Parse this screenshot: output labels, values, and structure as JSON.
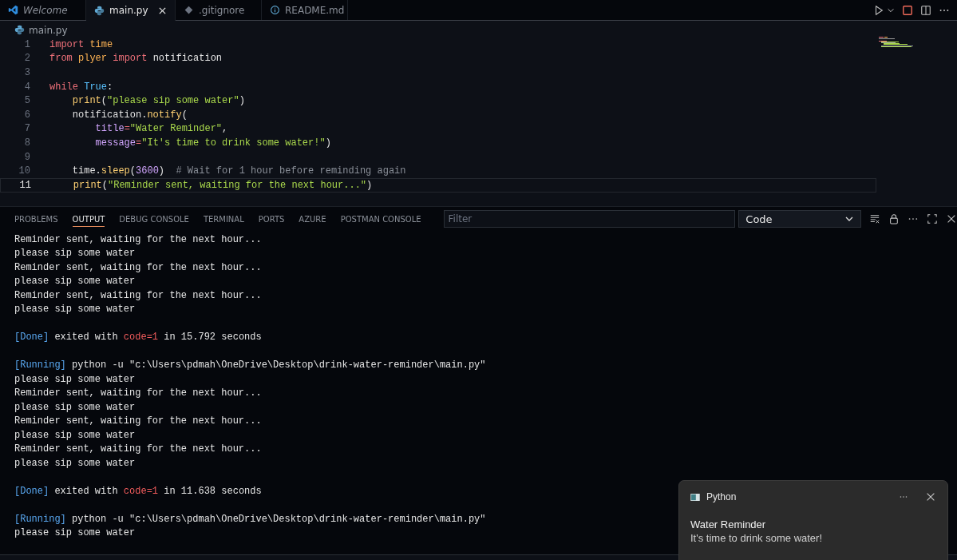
{
  "editor_tabs": [
    {
      "label": "Welcome",
      "kind": "vscode",
      "selected": false,
      "italic": true
    },
    {
      "label": "main.py",
      "kind": "python",
      "selected": true,
      "italic": false
    },
    {
      "label": ".gitignore",
      "kind": "git",
      "selected": false,
      "italic": false
    },
    {
      "label": "README.md",
      "kind": "info",
      "selected": false,
      "italic": false
    }
  ],
  "breadcrumb": "main.py",
  "code_lines": [
    {
      "number": "1",
      "current": false,
      "tokens": [
        {
          "kind": "keyword",
          "text": "import"
        },
        {
          "kind": "module",
          "text": " time"
        }
      ]
    },
    {
      "number": "2",
      "current": false,
      "tokens": [
        {
          "kind": "keyword",
          "text": "from"
        },
        {
          "kind": "module",
          "text": " plyer"
        },
        {
          "kind": "keyword",
          "text": " import"
        },
        {
          "kind": "plain",
          "text": " notification"
        }
      ]
    },
    {
      "number": "3",
      "current": false
    },
    {
      "number": "4",
      "current": false,
      "tokens": [
        {
          "kind": "keyword",
          "text": "while"
        },
        {
          "kind": "constant",
          "text": " True"
        },
        {
          "kind": "plain",
          "text": ":"
        }
      ]
    },
    {
      "number": "5",
      "current": false,
      "tokens": [
        {
          "kind": "func",
          "text": "    print"
        },
        {
          "kind": "plain",
          "text": "("
        },
        {
          "kind": "string",
          "text": "\"please sip some water\""
        },
        {
          "kind": "plain",
          "text": ")"
        }
      ]
    },
    {
      "number": "6",
      "current": false,
      "tokens": [
        {
          "kind": "plain",
          "text": "    notification."
        },
        {
          "kind": "func",
          "text": "notify"
        },
        {
          "kind": "plain",
          "text": "("
        }
      ]
    },
    {
      "number": "7",
      "current": false,
      "tokens": [
        {
          "kind": "param",
          "text": "        title"
        },
        {
          "kind": "keyword",
          "text": "="
        },
        {
          "kind": "string",
          "text": "\"Water Reminder\""
        },
        {
          "kind": "plain",
          "text": ","
        }
      ]
    },
    {
      "number": "8",
      "current": false,
      "tokens": [
        {
          "kind": "param",
          "text": "        message"
        },
        {
          "kind": "keyword",
          "text": "="
        },
        {
          "kind": "string",
          "text": "\"It's time to drink some water!\""
        },
        {
          "kind": "plain",
          "text": ")"
        }
      ]
    },
    {
      "number": "9",
      "current": false
    },
    {
      "number": "10",
      "current": false,
      "tokens": [
        {
          "kind": "plain",
          "text": "    time."
        },
        {
          "kind": "func",
          "text": "sleep"
        },
        {
          "kind": "plain",
          "text": "("
        },
        {
          "kind": "number",
          "text": "3600"
        },
        {
          "kind": "plain",
          "text": ")"
        },
        {
          "kind": "comment",
          "text": "  # Wait for 1 hour before reminding again"
        }
      ]
    },
    {
      "number": "11",
      "current": true,
      "tokens": [
        {
          "kind": "func",
          "text": "    print"
        },
        {
          "kind": "plain",
          "text": "("
        },
        {
          "kind": "string",
          "text": "\"Reminder sent, waiting for the next hour...\""
        },
        {
          "kind": "plain",
          "text": ")"
        }
      ]
    }
  ],
  "panel_tabs": [
    {
      "label": "PROBLEMS",
      "selected": false
    },
    {
      "label": "OUTPUT",
      "selected": true
    },
    {
      "label": "DEBUG CONSOLE",
      "selected": false
    },
    {
      "label": "TERMINAL",
      "selected": false
    },
    {
      "label": "PORTS",
      "selected": false
    },
    {
      "label": "AZURE",
      "selected": false
    },
    {
      "label": "POSTMAN CONSOLE",
      "selected": false
    }
  ],
  "filter": {
    "placeholder": "Filter"
  },
  "channel_select": {
    "value": "Code"
  },
  "output_lines": [
    {
      "kind": "text",
      "segments": [
        {
          "kind": "plain",
          "text": "Reminder sent, waiting for the next hour..."
        }
      ]
    },
    {
      "kind": "text",
      "segments": [
        {
          "kind": "plain",
          "text": "please sip some water"
        }
      ]
    },
    {
      "kind": "text",
      "segments": [
        {
          "kind": "plain",
          "text": "Reminder sent, waiting for the next hour..."
        }
      ]
    },
    {
      "kind": "text",
      "segments": [
        {
          "kind": "plain",
          "text": "please sip some water"
        }
      ]
    },
    {
      "kind": "text",
      "segments": [
        {
          "kind": "plain",
          "text": "Reminder sent, waiting for the next hour..."
        }
      ]
    },
    {
      "kind": "text",
      "segments": [
        {
          "kind": "plain",
          "text": "please sip some water"
        }
      ]
    },
    {
      "kind": "blank"
    },
    {
      "kind": "text",
      "segments": [
        {
          "kind": "tag",
          "text": "[Done]"
        },
        {
          "kind": "plain",
          "text": " exited with "
        },
        {
          "kind": "error",
          "text": "code=1"
        },
        {
          "kind": "plain",
          "text": " in 15.792 seconds"
        }
      ]
    },
    {
      "kind": "blank"
    },
    {
      "kind": "text",
      "segments": [
        {
          "kind": "tag",
          "text": "[Running]"
        },
        {
          "kind": "command",
          "text": " python -u \"c:\\Users\\pdmah\\OneDrive\\Desktop\\drink-water-reminder\\main.py\""
        }
      ]
    },
    {
      "kind": "text",
      "segments": [
        {
          "kind": "plain",
          "text": "please sip some water"
        }
      ]
    },
    {
      "kind": "text",
      "segments": [
        {
          "kind": "plain",
          "text": "Reminder sent, waiting for the next hour..."
        }
      ]
    },
    {
      "kind": "text",
      "segments": [
        {
          "kind": "plain",
          "text": "please sip some water"
        }
      ]
    },
    {
      "kind": "text",
      "segments": [
        {
          "kind": "plain",
          "text": "Reminder sent, waiting for the next hour..."
        }
      ]
    },
    {
      "kind": "text",
      "segments": [
        {
          "kind": "plain",
          "text": "please sip some water"
        }
      ]
    },
    {
      "kind": "text",
      "segments": [
        {
          "kind": "plain",
          "text": "Reminder sent, waiting for the next hour..."
        }
      ]
    },
    {
      "kind": "text",
      "segments": [
        {
          "kind": "plain",
          "text": "please sip some water"
        }
      ]
    },
    {
      "kind": "blank"
    },
    {
      "kind": "text",
      "segments": [
        {
          "kind": "tag",
          "text": "[Done]"
        },
        {
          "kind": "plain",
          "text": " exited with "
        },
        {
          "kind": "error",
          "text": "code=1"
        },
        {
          "kind": "plain",
          "text": " in 11.638 seconds"
        }
      ]
    },
    {
      "kind": "blank"
    },
    {
      "kind": "text",
      "segments": [
        {
          "kind": "tag",
          "text": "[Running]"
        },
        {
          "kind": "command",
          "text": " python -u \"c:\\Users\\pdmah\\OneDrive\\Desktop\\drink-water-reminder\\main.py\""
        }
      ]
    },
    {
      "kind": "text",
      "segments": [
        {
          "kind": "plain",
          "text": "please sip some water"
        }
      ]
    }
  ],
  "notification": {
    "app": "Python",
    "title": "Water Reminder",
    "message": "It's time to drink some water!"
  }
}
